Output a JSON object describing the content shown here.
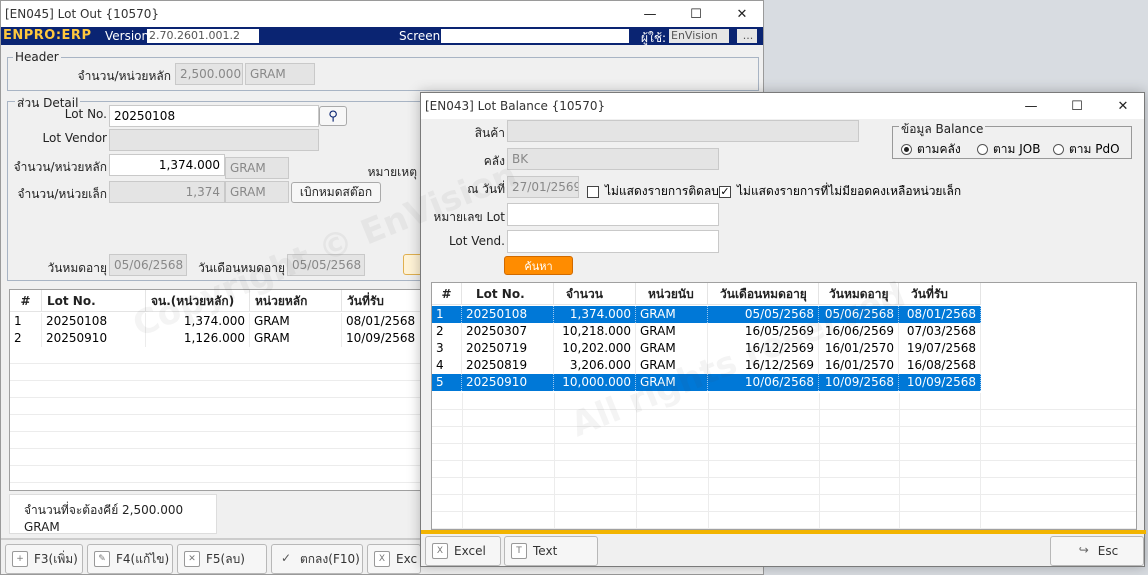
{
  "back": {
    "title": "[EN045] Lot Out {10570}",
    "brand": "ENPRO:ERP",
    "version_label": "Version",
    "version": "2.70.2601.001.2",
    "screen_label": "Screen:",
    "user_label": "ผู้ใช้:",
    "user": "EnVision",
    "user_btn": "...",
    "header": {
      "legend": "Header",
      "qty_label": "จำนวน/หน่วยหลัก",
      "qty": "2,500.000",
      "unit": "GRAM"
    },
    "detail": {
      "legend": "ส่วน Detail",
      "lot_label": "Lot No.",
      "lot": "20250108",
      "vendor_label": "Lot Vendor",
      "qty_main_label": "จำนวน/หน่วยหลัก",
      "qty_main": "1,374.000",
      "qty_main_unit": "GRAM",
      "remark_label": "หมายเหตุ",
      "qty_small_label": "จำนวน/หน่วยเล็ก",
      "qty_small": "1,374",
      "qty_small_unit": "GRAM",
      "withdraw_btn": "เบิกหมดสต๊อก",
      "exp_label": "วันหมดอายุ",
      "exp": "05/06/2568",
      "exp_month_label": "วันเดือนหมดอายุ",
      "exp_month": "05/05/2568"
    },
    "grid": {
      "columns": [
        "#",
        "Lot No.",
        "จน.(หน่วยหลัก)",
        "หน่วยหลัก",
        "วันที่รับ"
      ],
      "rows": [
        [
          "1",
          "20250108",
          "1,374.000",
          "GRAM",
          "08/01/2568"
        ],
        [
          "2",
          "20250910",
          "1,126.000",
          "GRAM",
          "10/09/2568"
        ]
      ]
    },
    "summary": "จำนวนที่จะต้องคีย์  2,500.000 GRAM",
    "buttons": {
      "add": "F3(เพิ่ม)",
      "edit": "F4(แก้ไข)",
      "delete": "F5(ลบ)",
      "ok": "ตกลง(F10)",
      "excel": "Exc"
    }
  },
  "front": {
    "title": "[EN043] Lot Balance {10570}",
    "product_label": "สินค้า",
    "warehouse_label": "คลัง",
    "warehouse": "BK",
    "date_label": "ณ วันที่",
    "date": "27/01/2569",
    "chk_neg": "ไม่แสดงรายการติดลบ",
    "chk_noremain": "ไม่แสดงรายการที่ไม่มียอดคงเหลือหน่วยเล็ก",
    "lot_label": "หมายเลข Lot",
    "vend_label": "Lot Vend.",
    "search_btn": "ค้นหา",
    "balance": {
      "legend": "ข้อมูล Balance",
      "opt_wh": "ตามคลัง",
      "opt_job": "ตาม JOB",
      "opt_pdo": "ตาม PdO"
    },
    "grid": {
      "columns": [
        "#",
        "Lot No.",
        "จำนวน",
        "หน่วยนับ",
        "วันเดือนหมดอายุ",
        "วันหมดอายุ",
        "วันที่รับ"
      ],
      "rows": [
        [
          "1",
          "20250108",
          "1,374.000",
          "GRAM",
          "05/05/2568",
          "05/06/2568",
          "08/01/2568"
        ],
        [
          "2",
          "20250307",
          "10,218.000",
          "GRAM",
          "16/05/2569",
          "16/06/2569",
          "07/03/2568"
        ],
        [
          "3",
          "20250719",
          "10,202.000",
          "GRAM",
          "16/12/2569",
          "16/01/2570",
          "19/07/2568"
        ],
        [
          "4",
          "20250819",
          "3,206.000",
          "GRAM",
          "16/12/2569",
          "16/01/2570",
          "16/08/2568"
        ],
        [
          "5",
          "20250910",
          "10,000.000",
          "GRAM",
          "10/06/2568",
          "10/09/2568",
          "10/09/2568"
        ]
      ],
      "selected": [
        0,
        4
      ]
    },
    "buttons": {
      "excel": "Excel",
      "text": "Text",
      "esc": "Esc"
    }
  },
  "colors": {
    "brand_band": "#0a2472",
    "brand_text": "#ffc83d",
    "selection": "#0078d7",
    "accent_orange": "#ff8c00"
  }
}
